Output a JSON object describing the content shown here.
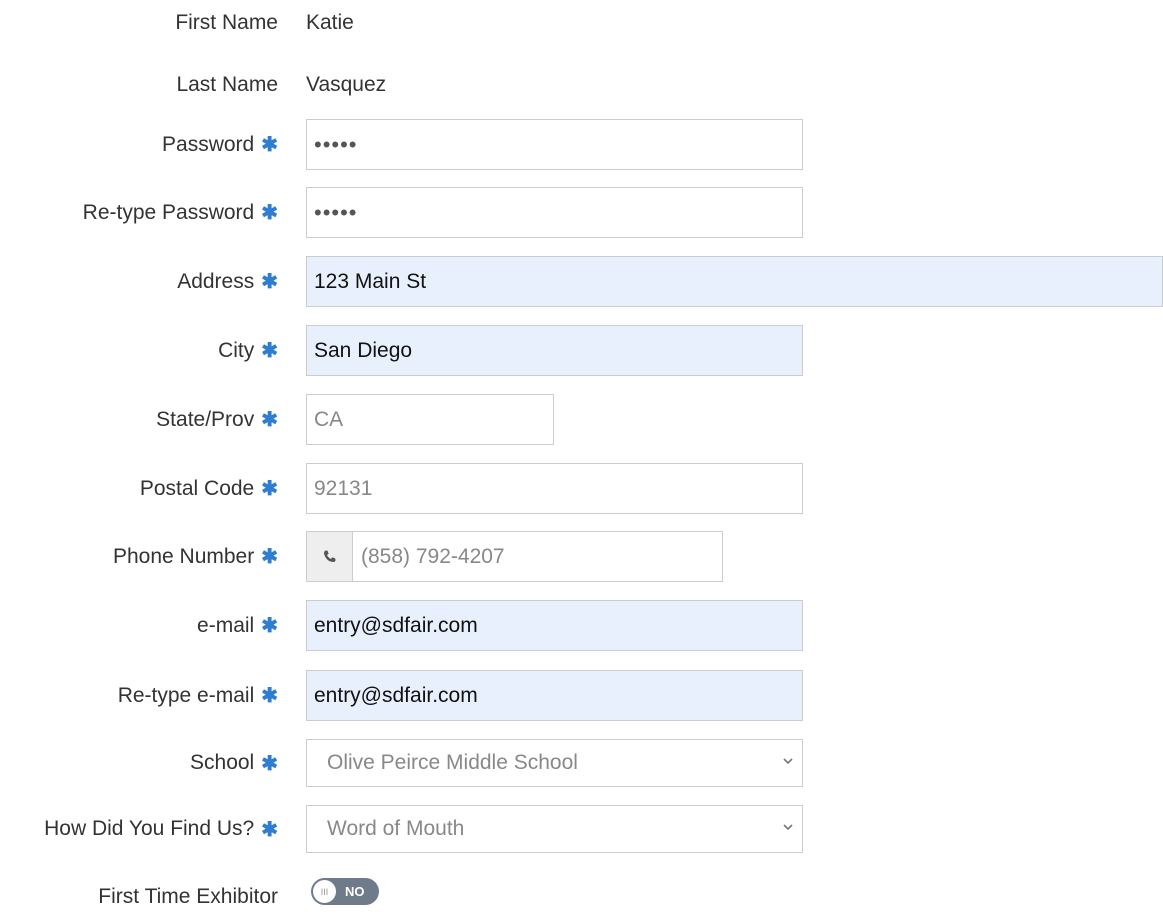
{
  "form": {
    "first_name": {
      "label": "First Name",
      "value": "Katie"
    },
    "last_name": {
      "label": "Last Name",
      "value": "Vasquez"
    },
    "password": {
      "label": "Password",
      "value": "•••••"
    },
    "retype_password": {
      "label": "Re-type Password",
      "value": "•••••"
    },
    "address": {
      "label": "Address",
      "value": "123 Main St"
    },
    "city": {
      "label": "City",
      "value": "San Diego"
    },
    "state": {
      "label": "State/Prov",
      "value": "CA"
    },
    "postal": {
      "label": "Postal Code",
      "value": "92131"
    },
    "phone": {
      "label": "Phone Number",
      "value": "(858) 792-4207",
      "icon": "phone-icon"
    },
    "email": {
      "label": "e-mail",
      "value": "entry@sdfair.com"
    },
    "retype_email": {
      "label": "Re-type e-mail",
      "value": "entry@sdfair.com"
    },
    "school": {
      "label": "School",
      "value": "Olive Peirce Middle School"
    },
    "found_us": {
      "label": "How Did You Find Us?",
      "value": "Word of Mouth"
    },
    "first_time": {
      "label": "First Time Exhibitor",
      "toggle_text": "NO",
      "knob_text": "III"
    }
  },
  "required_marker": "✱",
  "colors": {
    "required": "#2f7dd1",
    "autofill": "#e8f0fe",
    "toggle_off": "#6f7b8a"
  }
}
